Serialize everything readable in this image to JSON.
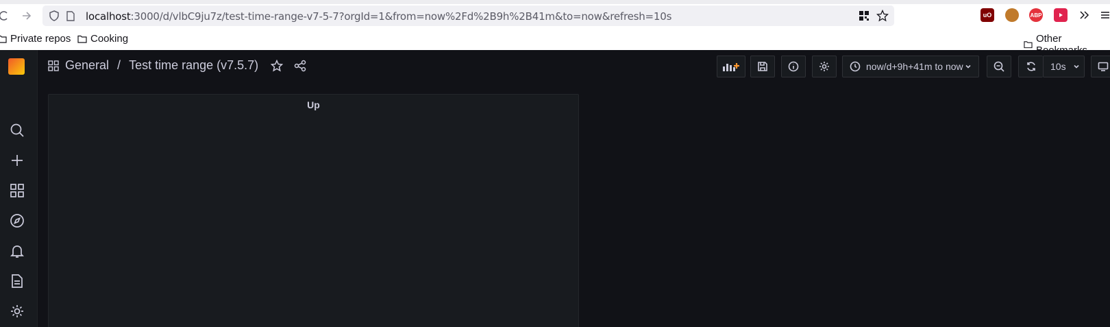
{
  "browser": {
    "url_host": "localhost",
    "url_rest": ":3000/d/vlbC9ju7z/test-time-range-v7-5-7?orgId=1&from=now%2Fd%2B9h%2B41m&to=now&refresh=10s",
    "bookmarks": [
      {
        "label": "Private repos",
        "icon": "folder-icon"
      },
      {
        "label": "Cooking",
        "icon": "folder-icon"
      }
    ],
    "other_bookmarks": "Other Bookmarks",
    "extensions": [
      {
        "name": "ublock-icon",
        "text": "uO",
        "color": "#800000"
      },
      {
        "name": "tampermonkey-icon",
        "text": "",
        "color": "#c07a2b"
      },
      {
        "name": "adblock-plus-icon",
        "text": "ABP",
        "color": "#e4323c"
      },
      {
        "name": "youtube-ext-icon",
        "text": "",
        "color": "#e0234e"
      }
    ]
  },
  "grafana": {
    "breadcrumb": {
      "folder": "General",
      "separator": "/",
      "dashboard": "Test time range (v7.5.7)"
    },
    "time_range": "now/d+9h+41m to now",
    "refresh": "10s",
    "panel": {
      "title": "Up"
    },
    "sidemenu": [
      "search-icon",
      "plus-icon",
      "dashboards-icon",
      "explore-icon",
      "alerting-icon",
      "reports-icon",
      "configuration-icon"
    ]
  }
}
